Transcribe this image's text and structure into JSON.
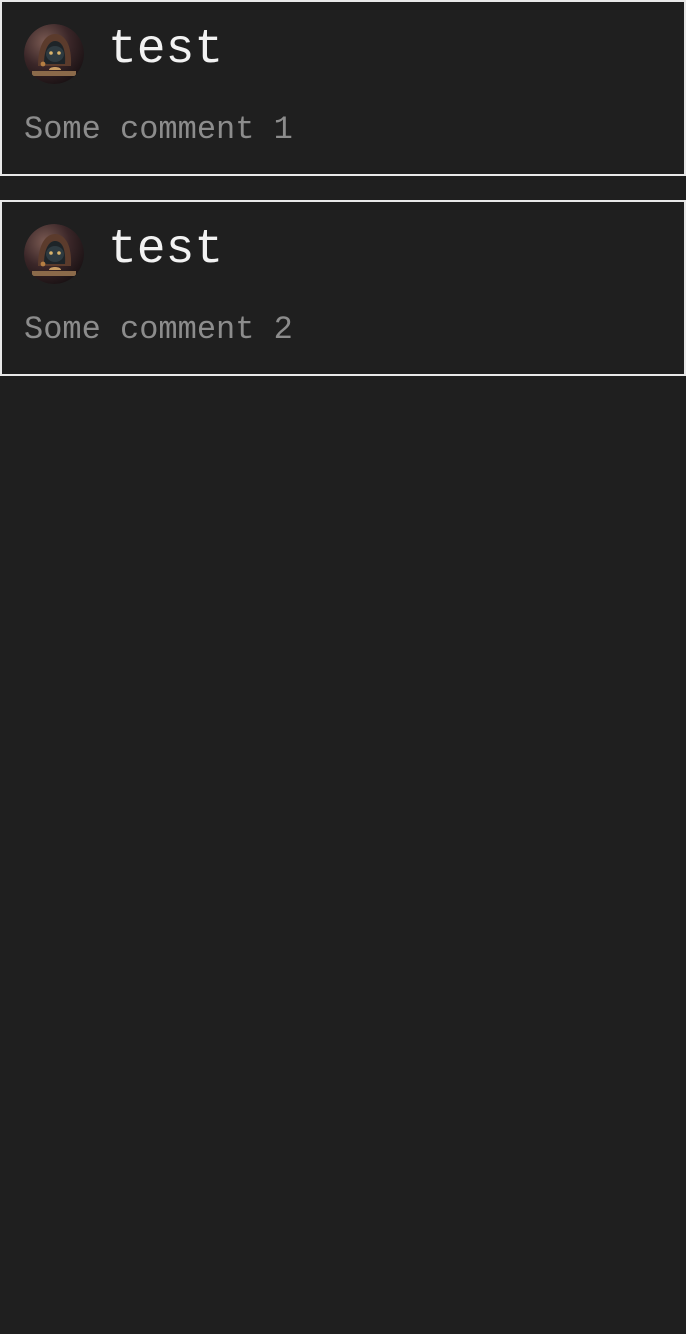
{
  "theme": {
    "background": "#1f1f1f",
    "card_border": "#e8e8e8",
    "username_color": "#f2f2f2",
    "comment_color": "#8c8c8c"
  },
  "comments": [
    {
      "avatar_icon": "hooded-cat-avatar-icon",
      "username": "test",
      "text": "Some comment 1"
    },
    {
      "avatar_icon": "hooded-cat-avatar-icon",
      "username": "test",
      "text": "Some comment 2"
    }
  ]
}
